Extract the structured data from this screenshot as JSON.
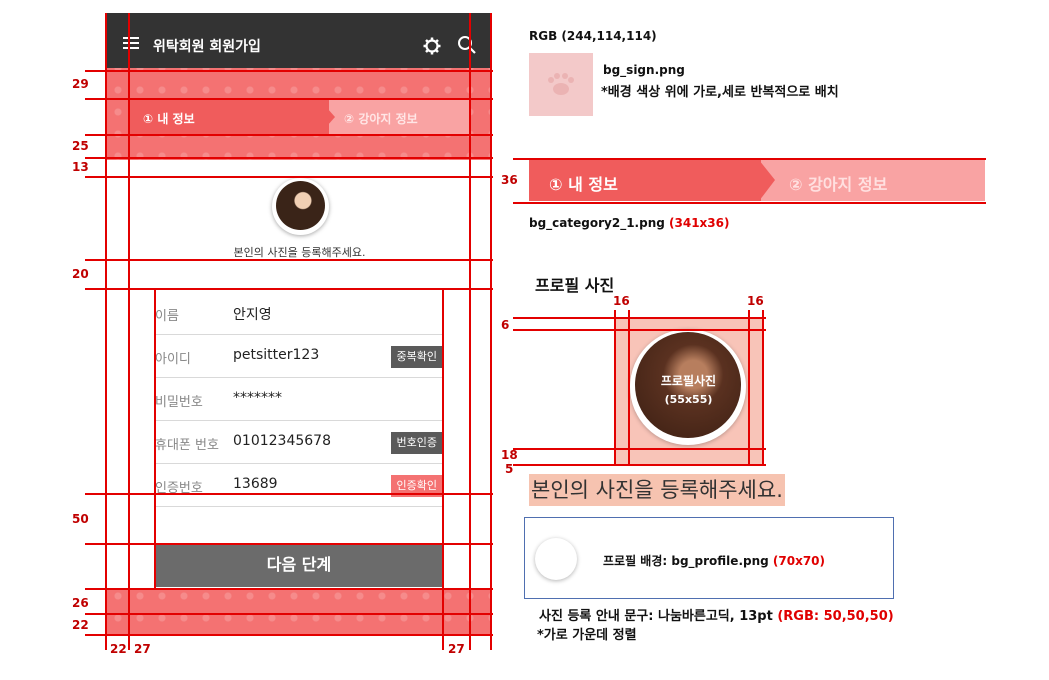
{
  "app": {
    "title": "위탁회원 회원가입"
  },
  "steps": {
    "step1": "① 내 정보",
    "step2": "② 강아지 정보"
  },
  "profile": {
    "guide": "본인의 사진을 등록해주세요."
  },
  "form": {
    "rows": [
      {
        "label": "이름",
        "value": "안지영",
        "button": ""
      },
      {
        "label": "아이디",
        "value": "petsitter123",
        "button": "중복확인"
      },
      {
        "label": "비밀번호",
        "value": "*******",
        "button": ""
      },
      {
        "label": "휴대폰 번호",
        "value": "01012345678",
        "button": "번호인증"
      },
      {
        "label": "인증번호",
        "value": "13689",
        "button": "인증확인"
      }
    ],
    "next": "다음 단계"
  },
  "dims": {
    "d29": "29",
    "d25": "25",
    "d13": "13",
    "d20": "20",
    "d50": "50",
    "d26": "26",
    "d22": "22",
    "b22": "22",
    "b27a": "27",
    "b27b": "27",
    "d36": "36",
    "p16a": "16",
    "p16b": "16",
    "p6": "6",
    "p18": "18",
    "p5": "5"
  },
  "annotations": {
    "rgb": "RGB (244,114,114)",
    "bg_sign": "bg_sign.png",
    "bg_sign_note": "*배경 색상 위에 가로,세로 반복적으로 배치",
    "cat_step1": "① 내 정보",
    "cat_step2": "② 강아지 정보",
    "cat_file": "bg_category2_1.png",
    "cat_size": "(341x36)",
    "profile_heading": "프로필 사진",
    "profile_label": "프로필사진",
    "profile_size": "(55x55)",
    "guide_sample": "본인의 사진을 등록해주세요.",
    "profile_bg_label": "프로필 배경: ",
    "profile_bg_file": "bg_profile.png",
    "profile_bg_size": "(70x70)",
    "font_note": "사진 등록 안내 문구: 나눔바른고딕, 13pt ",
    "font_rgb": "(RGB: 50,50,50)",
    "center_note": "*가로 가운데 정렬"
  },
  "colors": {
    "bg_sign": "#f47272",
    "topbar": "#333333",
    "text_guide": "#323232"
  }
}
